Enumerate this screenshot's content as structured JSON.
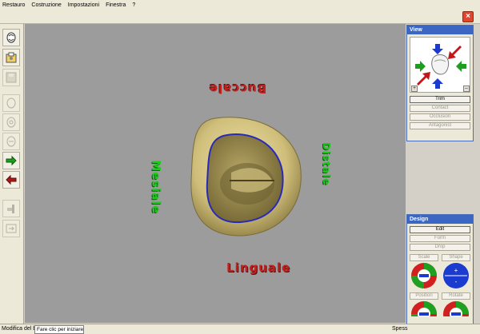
{
  "menu": {
    "items": [
      "Restauro",
      "Costruzione",
      "Impostazioni",
      "Finestra",
      "?"
    ]
  },
  "window": {
    "close_symbol": "×"
  },
  "toolbar": {
    "buttons": [
      {
        "icon": "tooth-icon",
        "enabled": true
      },
      {
        "icon": "open-folder-icon",
        "enabled": true
      },
      {
        "icon": "save-icon",
        "enabled": false
      },
      {
        "icon": "tooth-outline-icon",
        "enabled": false
      },
      {
        "icon": "tooth-outline-icon",
        "enabled": false
      },
      {
        "icon": "tooth-outline-icon",
        "enabled": false
      },
      {
        "icon": "arrow-right-green-icon",
        "enabled": true
      },
      {
        "icon": "arrow-left-red-icon",
        "enabled": true
      },
      {
        "icon": "tool-icon",
        "enabled": false
      },
      {
        "icon": "export-icon",
        "enabled": false
      }
    ]
  },
  "viewport": {
    "labels": {
      "buccale": "Buccale",
      "mesiale": "Mesiale",
      "distale": "Distale",
      "linguale": "Linguale"
    },
    "label_colors": {
      "red": "#c0201e",
      "green": "#1ec81e"
    }
  },
  "view_panel": {
    "title": "View",
    "plus": "+",
    "minus": "–",
    "buttons": [
      {
        "label": "Trim",
        "active": true
      },
      {
        "label": "Contact",
        "active": false
      },
      {
        "label": "Occlusion",
        "active": false
      },
      {
        "label": "Antagonist",
        "active": false
      }
    ]
  },
  "design_panel": {
    "title": "Design",
    "buttons": [
      {
        "label": "Edit",
        "active": true
      },
      {
        "label": "Form",
        "active": false
      },
      {
        "label": "Drop",
        "active": false
      }
    ],
    "scale_label": "Scale",
    "shape_label": "Shape",
    "position_label": "Position",
    "rotate_label": "Rotate",
    "shape_plus": "+",
    "shape_minus": "-"
  },
  "status": {
    "left_text": "Modifica del bo",
    "field_text": "Fare clic per iniziare...",
    "right_text": "Spess"
  }
}
